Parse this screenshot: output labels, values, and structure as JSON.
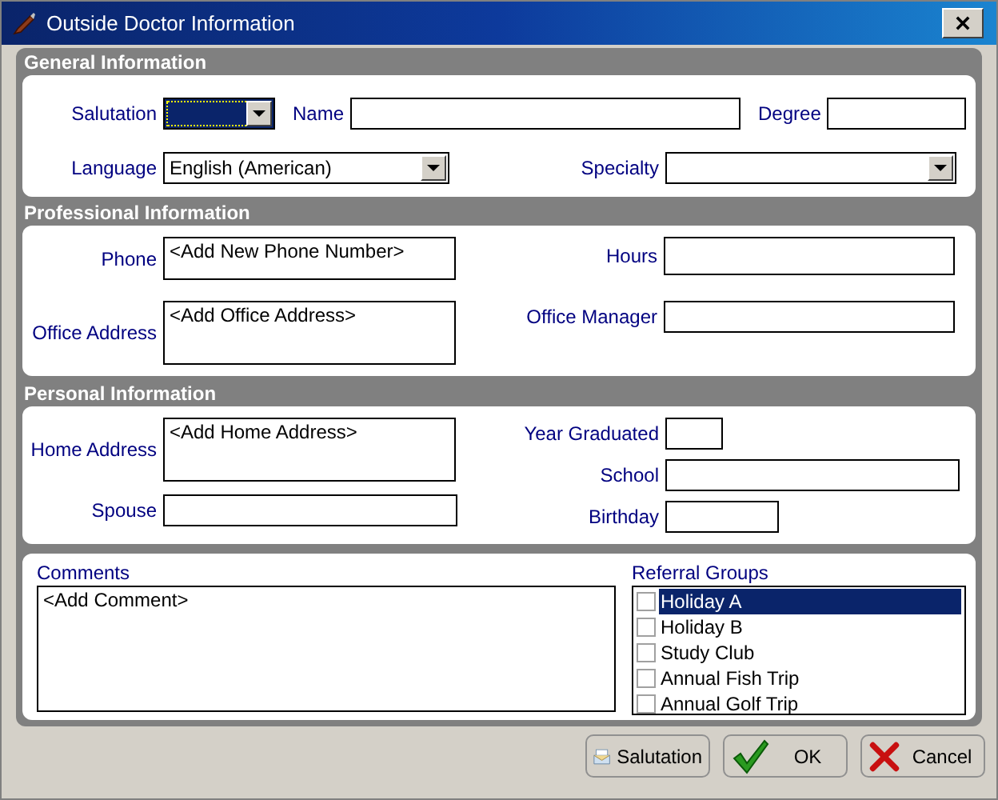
{
  "window": {
    "title": "Outside Doctor Information"
  },
  "general": {
    "heading": "General Information",
    "row_1": [
      {
        "label": "Salutation",
        "kind": "select",
        "focused": true
      },
      {
        "label": "Name",
        "kind": "text"
      },
      {
        "label": "Degree",
        "kind": "text"
      }
    ],
    "row_2": [
      {
        "label": "Language",
        "kind": "select",
        "value": "English (American)"
      },
      {
        "label": "Specialty",
        "kind": "select"
      }
    ]
  },
  "professional": {
    "heading": "Professional Information",
    "left": [
      {
        "label": "Phone",
        "value": "<Add New Phone Number>"
      },
      {
        "label": "Office Address",
        "value": "<Add Office Address>"
      }
    ],
    "right": [
      {
        "label": "Hours"
      },
      {
        "label": "Office Manager"
      }
    ]
  },
  "personal": {
    "heading": "Personal Information",
    "left": [
      {
        "label": "Home Address",
        "value": "<Add Home Address>"
      },
      {
        "label": "Spouse"
      }
    ],
    "right": [
      {
        "label": "Year Graduated"
      },
      {
        "label": "School"
      },
      {
        "label": "Birthday"
      }
    ]
  },
  "comments": {
    "label": "Comments",
    "value": "<Add Comment>"
  },
  "referral_groups": {
    "label": "Referral Groups",
    "items": [
      {
        "label": "Holiday A",
        "checked": false,
        "selected": true
      },
      {
        "label": "Holiday B",
        "checked": false,
        "selected": false
      },
      {
        "label": "Study Club",
        "checked": false,
        "selected": false
      },
      {
        "label": "Annual Fish Trip",
        "checked": false,
        "selected": false
      },
      {
        "label": "Annual Golf Trip",
        "checked": false,
        "selected": false
      }
    ]
  },
  "buttons": [
    {
      "label": "Salutation",
      "kind": "salutation"
    },
    {
      "label": "OK",
      "kind": "ok"
    },
    {
      "label": "Cancel",
      "kind": "cancel"
    }
  ]
}
